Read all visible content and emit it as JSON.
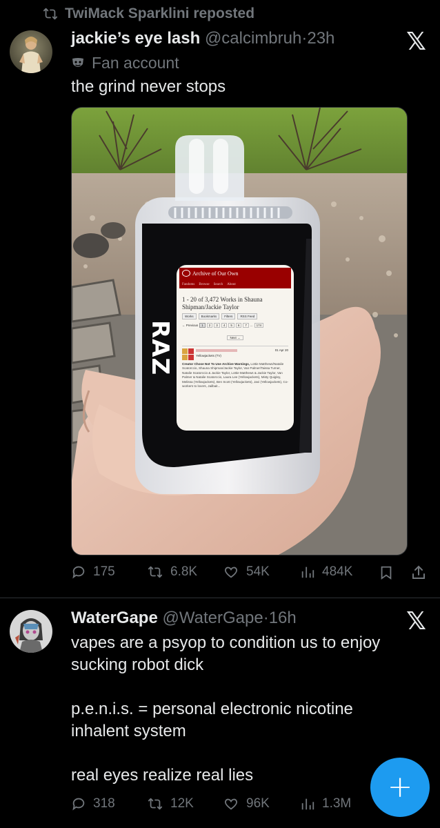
{
  "repost": {
    "text": "TwiMack Sparklini reposted",
    "icon": "repost-icon"
  },
  "tweet1": {
    "display_name": "jackie’s eye lash",
    "handle": "@calcimbruh",
    "sep": "·",
    "time": "23h",
    "label_text": "Fan account",
    "text": "the grind never stops",
    "media": {
      "device_brand": "RAZ",
      "screen": {
        "site": "Archive of Our Own",
        "nav": [
          "Fandoms",
          "Browse",
          "Search",
          "About"
        ],
        "heading_line1": "1 - 20 of 3,472 Works in Shauna",
        "heading_line2": "Shipman/Jackie Taylor",
        "buttons": [
          "Works",
          "Bookmarks",
          "Filters",
          "RSS Feed"
        ],
        "pager_prev": "← Previous",
        "pages": [
          "1",
          "2",
          "3",
          "4",
          "5",
          "6",
          "7",
          "...",
          "174"
        ],
        "pager_next": "Next →",
        "fandom": "Yellowjackets (TV)",
        "date": "01 Apr 20",
        "tags_bold": "Creator Chose Not To Use Archive Warnings,",
        "tags": "Lottie Matthews/Natalie Scatorccio, Shauna Shipman/Jackie Taylor, Van Palmer/Taissa Turner, Natalie Scatorccio & Jackie Taylor, Lottie Matthews & Jackie Taylor, Van Palmer & Natalie Scatorccio, Laura Lee (Yellowjackets), Misty Quigley, Melissa (Yellowjackets), Ben Scott (Yellowjackets), Javi (Yellowjackets), Co-workers to lovers, Jailbait..."
      }
    },
    "metrics": {
      "replies": "175",
      "reposts": "6.8K",
      "likes": "54K",
      "views": "484K"
    }
  },
  "tweet2": {
    "display_name": "WaterGape",
    "handle": "@WaterGape",
    "sep": "·",
    "time": "16h",
    "line1": "vapes are a psyop to condition us to enjoy",
    "line2": "sucking robot dick",
    "line3": "p.e.n.i.s. = personal electronic nicotine",
    "line4": "inhalent system",
    "line5": "real eyes realize real lies",
    "metrics": {
      "replies": "318",
      "reposts": "12K",
      "likes": "96K",
      "views": "1.3M"
    }
  },
  "icons": {
    "platform_logo": "𝕏",
    "compose": "+"
  },
  "colors": {
    "background": "#000000",
    "text": "#e7e9ea",
    "muted": "#71767b",
    "accent": "#1d9bf0",
    "divider": "#2f3336"
  }
}
